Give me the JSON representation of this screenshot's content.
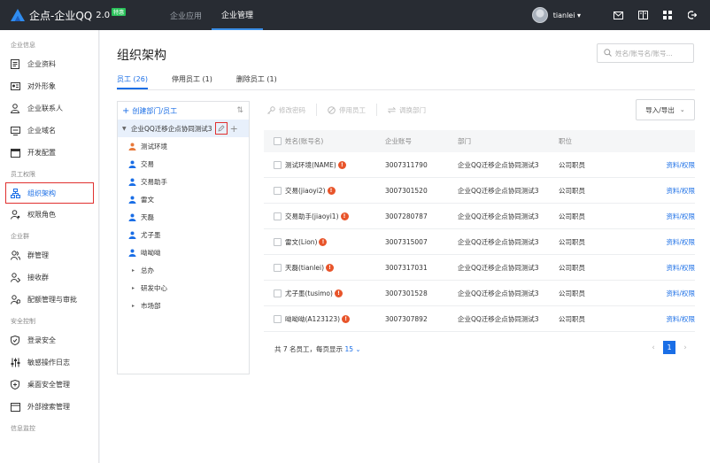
{
  "app": {
    "logo_text": "企点-企业QQ",
    "version": "2.0",
    "badge": "特惠"
  },
  "topnav": [
    {
      "label": "企业应用",
      "active": false
    },
    {
      "label": "企业管理",
      "active": true
    }
  ],
  "user": {
    "name": "tianlei"
  },
  "sidebar": {
    "sections": [
      {
        "title": "企业信息",
        "items": [
          "企业资料",
          "对外形象",
          "企业联系人",
          "企业域名",
          "开发配置"
        ]
      },
      {
        "title": "员工权限",
        "items": [
          "组织架构",
          "权限角色"
        ]
      },
      {
        "title": "企业群",
        "items": [
          "群管理",
          "接收群",
          "配额管理与审批"
        ]
      },
      {
        "title": "安全控制",
        "items": [
          "登录安全",
          "敏感操作日志",
          "桌面安全管理",
          "外部搜索管理"
        ]
      },
      {
        "title": "信息监控",
        "items": []
      }
    ],
    "active_item": "组织架构"
  },
  "main": {
    "title": "组织架构",
    "search_placeholder": "姓名/账号名/账号...",
    "tabs": [
      {
        "label": "员工 (26)",
        "active": true
      },
      {
        "label": "停用员工 (1)",
        "active": false
      },
      {
        "label": "删除员工 (1)",
        "active": false
      }
    ]
  },
  "tree": {
    "create_label": "创建部门/员工",
    "root": "企业QQ迁移企点协同测试3",
    "members": [
      {
        "name": "测试环境",
        "color": "#e8793a"
      },
      {
        "name": "交易",
        "color": "#1a6ee6"
      },
      {
        "name": "交易助手",
        "color": "#1a6ee6"
      },
      {
        "name": "雷文",
        "color": "#1a6ee6"
      },
      {
        "name": "天磊",
        "color": "#1a6ee6"
      },
      {
        "name": "尤子墨",
        "color": "#1a6ee6"
      },
      {
        "name": "呦呦呦",
        "color": "#1a6ee6"
      }
    ],
    "departments": [
      "总办",
      "研发中心",
      "市场部"
    ]
  },
  "toolbar": {
    "buttons": [
      "修改密码",
      "停用员工",
      "调换部门"
    ],
    "import_export": "导入/导出"
  },
  "table": {
    "headers": [
      "姓名(账号名)",
      "企业账号",
      "部门",
      "职位",
      ""
    ],
    "rows": [
      {
        "name": "测试环境(NAME)",
        "account": "3007311790",
        "dept": "企业QQ迁移企点协同测试3",
        "position": "公司职员",
        "action": "资料/权限"
      },
      {
        "name": "交易(jiaoyi2)",
        "account": "3007301520",
        "dept": "企业QQ迁移企点协同测试3",
        "position": "公司职员",
        "action": "资料/权限"
      },
      {
        "name": "交易助手(jiaoyi1)",
        "account": "3007280787",
        "dept": "企业QQ迁移企点协同测试3",
        "position": "公司职员",
        "action": "资料/权限"
      },
      {
        "name": "雷文(Lion)",
        "account": "3007315007",
        "dept": "企业QQ迁移企点协同测试3",
        "position": "公司职员",
        "action": "资料/权限"
      },
      {
        "name": "天磊(tianlei)",
        "account": "3007317031",
        "dept": "企业QQ迁移企点协同测试3",
        "position": "公司职员",
        "action": "资料/权限"
      },
      {
        "name": "尤子墨(tusimo)",
        "account": "3007301528",
        "dept": "企业QQ迁移企点协同测试3",
        "position": "公司职员",
        "action": "资料/权限"
      },
      {
        "name": "呦呦呦(A123123)",
        "account": "3007307892",
        "dept": "企业QQ迁移企点协同测试3",
        "position": "公司职员",
        "action": "资料/权限"
      }
    ]
  },
  "pagination": {
    "summary_prefix": "共 7 名员工，每页显示",
    "page_size": "15",
    "current_page": "1"
  }
}
